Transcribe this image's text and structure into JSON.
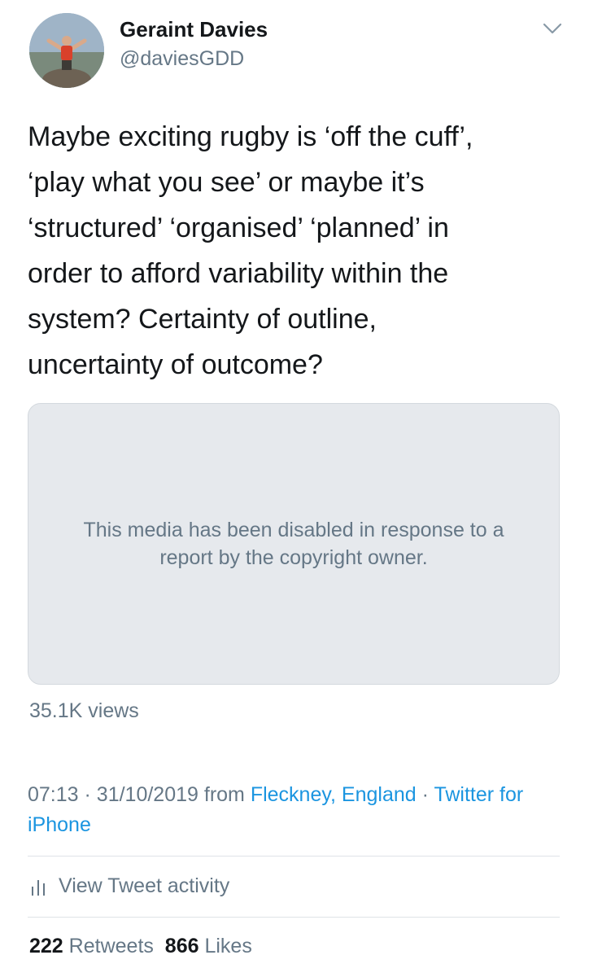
{
  "author": {
    "display_name": "Geraint Davies",
    "handle": "@daviesGDD"
  },
  "icons": {
    "menu": "chevron-down-icon",
    "activity": "bar-chart-icon"
  },
  "tweet": {
    "text": "Maybe exciting rugby is ‘off the cuff’,\n‘play what you see’ or maybe it’s\n‘structured’ ‘organised’ ‘planned’ in\norder to afford variability within the\nsystem? Certainty of outline,\nuncertainty of outcome?"
  },
  "media": {
    "notice": "This media has been disabled in response to a\nreport by the copyright owner."
  },
  "views": "35.1K views",
  "meta": {
    "time": "07:13",
    "date": "31/10/2019",
    "from_label": "from",
    "location": "Fleckney, England",
    "client": "Twitter for iPhone",
    "separator": "·"
  },
  "activity": {
    "label": "View Tweet activity"
  },
  "stats": {
    "retweets_count": "222",
    "retweets_label": "Retweets",
    "likes_count": "866",
    "likes_label": "Likes"
  },
  "colors": {
    "link": "#1b95e0",
    "secondary_text": "#657786",
    "primary_text": "#14171a",
    "media_background": "#e6e9ed"
  }
}
